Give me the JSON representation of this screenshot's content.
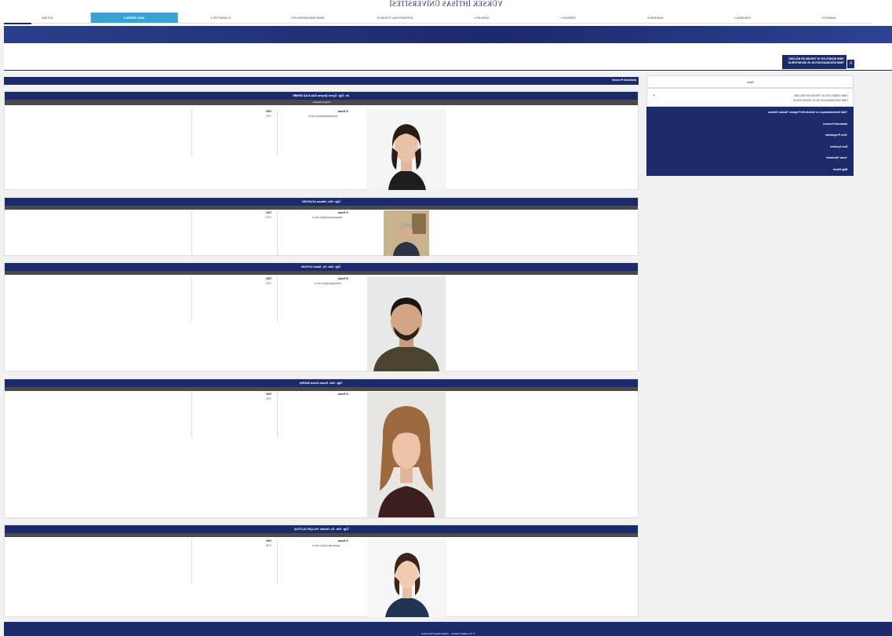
{
  "header": {
    "site_title": "YÜKSEK İHTİSAS ÜNİVERSİTESİ",
    "nav": [
      {
        "label": "ANASAYFA",
        "active": false
      },
      {
        "label": "KURUMSAL ▾",
        "active": false
      },
      {
        "label": "AKADEMİK ▾",
        "active": false
      },
      {
        "label": "ÖĞRENCİ ▾",
        "active": false
      },
      {
        "label": "YAYINLAR ▾",
        "active": false
      },
      {
        "label": "INTERNATIONAL STUDENTS",
        "active": false
      },
      {
        "label": "ARAŞTIRMA MERKEZLERİ",
        "active": false
      },
      {
        "label": "E-HİZMETLER ▾",
        "active": false
      },
      {
        "label": "ADAY ÖĞRENCİ",
        "active": true
      },
      {
        "label": "İLETİŞİM",
        "active": false
      }
    ]
  },
  "department": {
    "line1": "TIBBİ DÖKÜMANTASYON VE SEKRETERLİK",
    "line2": "TIBBİ HİZMETLER VE TEKNİKLER BÖLÜMÜ",
    "toggle": "≡"
  },
  "section_title": "Akademik Personel",
  "staff": [
    {
      "name": "Dr. Öğr. Üyesi Şeyma BALKAŞ DEMİR",
      "role": "Program Başkanı",
      "email_label": "E-Posta",
      "email": "seymabalkas@yiu.edu.tr",
      "yok_label": "YÖK",
      "yok": "YÖK"
    },
    {
      "name": "Öğr. Gör. Hakan ACAYDIN",
      "role": "",
      "email_label": "E-Posta",
      "email": "hakanacaydin@yiu.edu.tr",
      "yok_label": "YÖK",
      "yok": "YÖK"
    },
    {
      "name": "Öğr. Gör. Dr. Sabri UYGUN",
      "role": "",
      "email_label": "E-Posta",
      "email": "sabriuygun@yiu.edu.tr",
      "yok_label": "YÖK",
      "yok": "YÖK"
    },
    {
      "name": "Öğr. Gör. Esma Deniz BARIŞ",
      "role": "",
      "email_label": "E-Posta",
      "email": "",
      "yok_label": "YÖK",
      "yok": "YÖK"
    },
    {
      "name": "Öğr. Gör. Dr. Gözde YALÇIN ULUTAŞ",
      "role": "",
      "email_label": "E-Posta",
      "email": "gozdeyalcin@yiu.edu.tr",
      "yok_label": "YÖK",
      "yok": "YÖK"
    }
  ],
  "sidebar": {
    "heading": "Birimi",
    "dept_line1": "TIBBİ HİZMETLER VE TEKNİKLER BÖLÜMÜ",
    "dept_line2": "TIBBİ DÖKÜMANTASYON VE SEKRETERLİK",
    "items": [
      "Tıbbi Dokümantasyon ve Sekreterlik Programı Tanıtım Videosu",
      "Akademik Personel",
      "Ders Programları",
      "Ders İçerikleri",
      "Sınav Takvimleri",
      "Bilgi Paketi"
    ]
  },
  "footer": {
    "text": "© Tüm Hakları Saklıdır - Yüksek İhtisas Üniversitesi"
  }
}
